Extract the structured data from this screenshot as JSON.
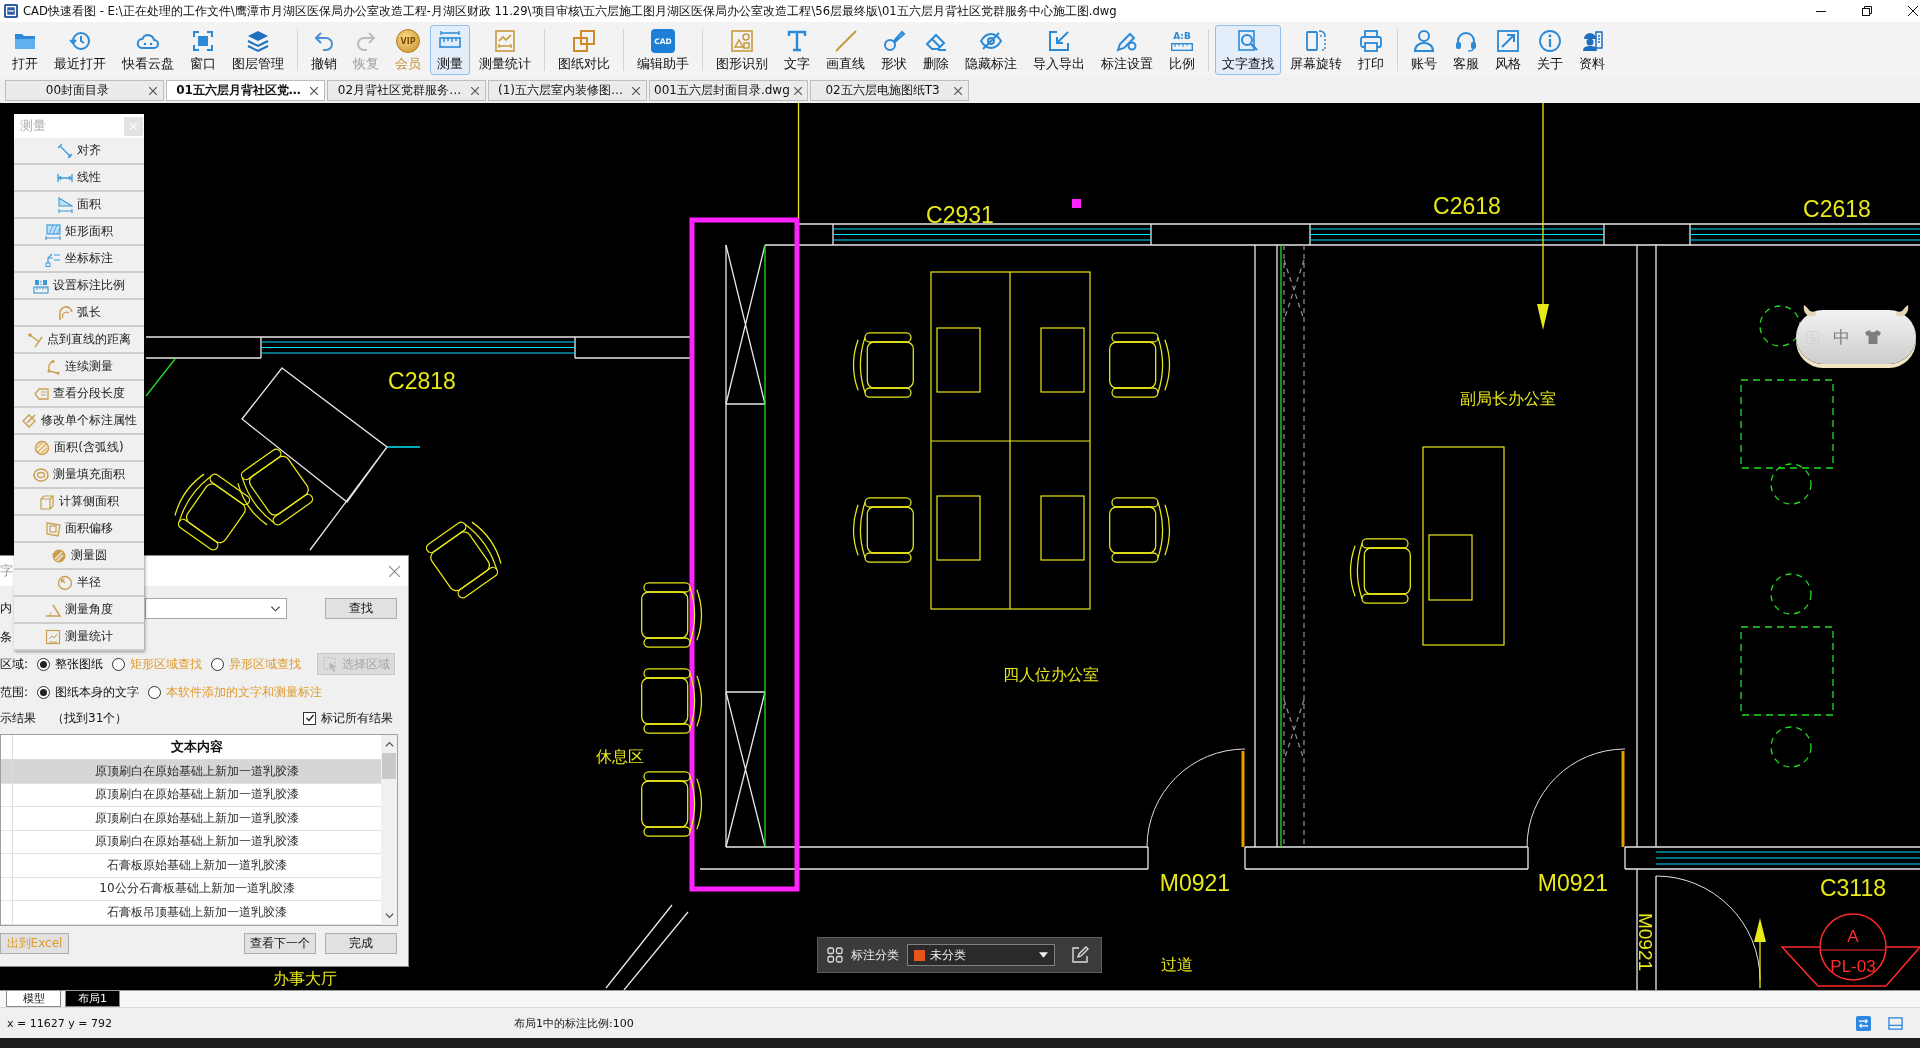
{
  "window": {
    "title": "CAD快速看图 - E:\\正在处理的工作文件\\鹰潭市月湖区医保局办公室改造工程-月湖区财政 11.29\\项目审核\\五六层施工图月湖区医保局办公室改造工程\\56层最终版\\01五六层月背社区党群服务中心施工图.dwg"
  },
  "toolbar": {
    "groups": [
      {
        "buttons": [
          {
            "label": "打开",
            "kind": "tool",
            "selected": false,
            "disabled": false
          },
          {
            "label": "最近打开",
            "kind": "tool",
            "selected": false,
            "disabled": false
          },
          {
            "label": "快看云盘",
            "kind": "tool",
            "selected": false,
            "disabled": false
          },
          {
            "label": "窗口",
            "kind": "tool",
            "selected": false,
            "disabled": false
          },
          {
            "label": "图层管理",
            "kind": "tool",
            "selected": false,
            "disabled": false
          }
        ]
      },
      {
        "buttons": [
          {
            "label": "撤销",
            "kind": "tool",
            "selected": false,
            "disabled": false
          },
          {
            "label": "恢复",
            "kind": "tool",
            "selected": false,
            "disabled": true
          },
          {
            "label": "会员",
            "kind": "vip",
            "badge": "VIP",
            "selected": false,
            "disabled": false
          },
          {
            "label": "测量",
            "kind": "tool",
            "selected": true,
            "disabled": false
          },
          {
            "label": "测量统计",
            "kind": "tool",
            "selected": false,
            "disabled": false
          }
        ]
      },
      {
        "buttons": [
          {
            "label": "图纸对比",
            "kind": "tool",
            "selected": false,
            "disabled": false
          }
        ]
      },
      {
        "buttons": [
          {
            "label": "编辑助手",
            "kind": "app",
            "badge": "CAD",
            "selected": false,
            "disabled": false
          }
        ]
      },
      {
        "buttons": [
          {
            "label": "图形识别",
            "kind": "tool",
            "selected": false,
            "disabled": false
          },
          {
            "label": "文字",
            "kind": "tool",
            "selected": false,
            "disabled": false
          },
          {
            "label": "画直线",
            "kind": "tool",
            "selected": false,
            "disabled": false
          },
          {
            "label": "形状",
            "kind": "tool",
            "selected": false,
            "disabled": false
          },
          {
            "label": "删除",
            "kind": "tool",
            "selected": false,
            "disabled": false
          },
          {
            "label": "隐藏标注",
            "kind": "tool",
            "selected": false,
            "disabled": false
          },
          {
            "label": "导入导出",
            "kind": "tool",
            "selected": false,
            "disabled": false
          },
          {
            "label": "标注设置",
            "kind": "tool",
            "selected": false,
            "disabled": false
          },
          {
            "label": "比例",
            "kind": "ratio",
            "badge": "A:B",
            "selected": false,
            "disabled": false
          }
        ]
      },
      {
        "buttons": [
          {
            "label": "文字查找",
            "kind": "tool",
            "selected": true,
            "disabled": false
          },
          {
            "label": "屏幕旋转",
            "kind": "tool",
            "selected": false,
            "disabled": false
          },
          {
            "label": "打印",
            "kind": "tool",
            "selected": false,
            "disabled": false
          }
        ]
      },
      {
        "buttons": [
          {
            "label": "账号",
            "kind": "tool",
            "selected": false,
            "disabled": false
          },
          {
            "label": "客服",
            "kind": "tool",
            "selected": false,
            "disabled": false
          },
          {
            "label": "风格",
            "kind": "tool",
            "selected": false,
            "disabled": false
          },
          {
            "label": "关于",
            "kind": "tool",
            "selected": false,
            "disabled": false
          },
          {
            "label": "资料",
            "kind": "tool",
            "selected": false,
            "disabled": false
          }
        ]
      }
    ]
  },
  "document_tabs": [
    {
      "label": "00封面目录",
      "selected": false
    },
    {
      "label": "01五六层月背社区党…",
      "selected": true
    },
    {
      "label": "02月背社区党群服务…",
      "selected": false
    },
    {
      "label": "(1)五六层室内装修图…",
      "selected": false
    },
    {
      "label": "001五六层封面目录.dwg",
      "selected": false
    },
    {
      "label": "02五六层电施图纸T3",
      "selected": false
    }
  ],
  "drawing": {
    "labels": [
      {
        "text": "C2931",
        "kind": "window"
      },
      {
        "text": "C2618",
        "kind": "window"
      },
      {
        "text": "C2618",
        "kind": "window"
      },
      {
        "text": "C2818",
        "kind": "window"
      },
      {
        "text": "副局长办公室",
        "kind": "room"
      },
      {
        "text": "四人位办公室",
        "kind": "room"
      },
      {
        "text": "休息区",
        "kind": "room"
      },
      {
        "text": "M0921",
        "kind": "door"
      },
      {
        "text": "M0921",
        "kind": "door"
      },
      {
        "text": "C3118",
        "kind": "window"
      },
      {
        "text": "过道",
        "kind": "room"
      },
      {
        "text": "办事大厅",
        "kind": "room"
      },
      {
        "text": "M0921",
        "kind": "door_vertical"
      }
    ],
    "callout": {
      "letter": "A",
      "sheet": "PL-03"
    }
  },
  "measure_panel": {
    "title": "测量",
    "items": [
      "对齐",
      "线性",
      "面积",
      "矩形面积",
      "坐标标注",
      "设置标注比例",
      "弧长",
      "点到直线的距离",
      "连续测量",
      "查看分段长度",
      "修改单个标注属性",
      "面积(含弧线)",
      "测量填充面积",
      "计算侧面积",
      "面积偏移",
      "测量圆",
      "半径",
      "测量角度",
      "测量统计"
    ]
  },
  "find_dialog": {
    "title": "字",
    "content_label": "内",
    "condition_label": "条",
    "search_button": "查找",
    "area": {
      "label": "区域:",
      "options": [
        {
          "label": "整张图纸",
          "kind": "basic",
          "selected": true
        },
        {
          "label": "矩形区域查找",
          "kind": "vip",
          "selected": false
        },
        {
          "label": "异形区域查找",
          "kind": "vip",
          "selected": false
        }
      ],
      "select_button": {
        "label": "选择区域",
        "disabled": true
      }
    },
    "scope": {
      "label": "范围:",
      "options": [
        {
          "label": "图纸本身的文字",
          "kind": "basic",
          "selected": true
        },
        {
          "label": "本软件添加的文字和测量标注",
          "kind": "vip",
          "selected": false
        }
      ]
    },
    "results_label": "示结果",
    "found": "（找到31个）",
    "mark_all": {
      "label": "标记所有结果",
      "checked": true
    },
    "table": {
      "header": "文本内容",
      "rows": [
        {
          "text": "原顶刷白在原始基础上新加一道乳胶漆",
          "selected": true
        },
        {
          "text": "原顶刷白在原始基础上新加一道乳胶漆",
          "selected": false
        },
        {
          "text": "原顶刷白在原始基础上新加一道乳胶漆",
          "selected": false
        },
        {
          "text": "原顶刷白在原始基础上新加一道乳胶漆",
          "selected": false
        },
        {
          "text": "石膏板原始基础上新加一道乳胶漆",
          "selected": false
        },
        {
          "text": "10公分石膏板基础上新加一道乳胶漆",
          "selected": false
        },
        {
          "text": "石膏板吊顶基础上新加一道乳胶漆",
          "selected": false
        }
      ]
    },
    "export_button": {
      "label": "出到Excel",
      "kind": "vip"
    },
    "next_button": "查看下一个",
    "done_button": "完成"
  },
  "annotation_bar": {
    "label": "标注分类",
    "category": {
      "value": "未分类",
      "color": "#e8541c"
    }
  },
  "ime_widget": {
    "mode": "中"
  },
  "layout_tabs": [
    {
      "label": "模型",
      "selected": false
    },
    {
      "label": "布局1",
      "selected": true
    }
  ],
  "status_bar": {
    "coordinates": "x = 11627 y = 792",
    "scale": "布局1中的标注比例:100"
  }
}
